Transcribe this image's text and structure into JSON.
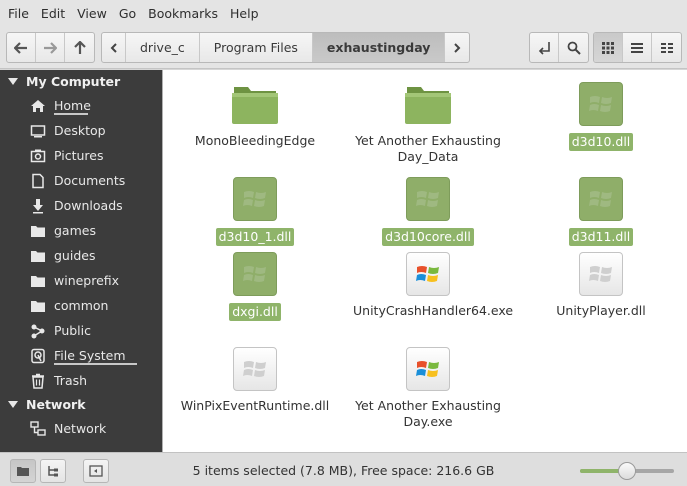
{
  "menubar": {
    "items": [
      "File",
      "Edit",
      "View",
      "Go",
      "Bookmarks",
      "Help"
    ]
  },
  "toolbar": {
    "breadcrumbs": [
      "drive_c",
      "Program Files",
      "exhaustingday"
    ],
    "active_crumb": "exhaustingday",
    "view_mode": "icons"
  },
  "sidebar": {
    "sections": [
      {
        "title": "My Computer",
        "items": [
          {
            "label": "Home",
            "icon": "home-icon",
            "underline": true
          },
          {
            "label": "Desktop",
            "icon": "desktop-icon"
          },
          {
            "label": "Pictures",
            "icon": "pictures-icon"
          },
          {
            "label": "Documents",
            "icon": "documents-icon"
          },
          {
            "label": "Downloads",
            "icon": "downloads-icon"
          },
          {
            "label": "games",
            "icon": "folder-icon"
          },
          {
            "label": "guides",
            "icon": "folder-icon"
          },
          {
            "label": "wineprefix",
            "icon": "folder-icon"
          },
          {
            "label": "common",
            "icon": "folder-icon"
          },
          {
            "label": "Public",
            "icon": "share-icon"
          },
          {
            "label": "File System",
            "icon": "harddisk-icon",
            "underline": true
          },
          {
            "label": "Trash",
            "icon": "trash-icon"
          }
        ]
      },
      {
        "title": "Network",
        "items": [
          {
            "label": "Network",
            "icon": "network-icon"
          }
        ]
      }
    ]
  },
  "files": [
    {
      "name": "MonoBleedingEdge",
      "type": "folder",
      "selected": false
    },
    {
      "name": "Yet Another Exhausting Day_Data",
      "type": "folder",
      "selected": false
    },
    {
      "name": "d3d10.dll",
      "type": "dll",
      "selected": true
    },
    {
      "name": "d3d10_1.dll",
      "type": "dll",
      "selected": true
    },
    {
      "name": "d3d10core.dll",
      "type": "dll",
      "selected": true
    },
    {
      "name": "d3d11.dll",
      "type": "dll",
      "selected": true
    },
    {
      "name": "dxgi.dll",
      "type": "dll",
      "selected": true
    },
    {
      "name": "UnityCrashHandler64.exe",
      "type": "exe",
      "selected": false
    },
    {
      "name": "UnityPlayer.dll",
      "type": "dll",
      "selected": false
    },
    {
      "name": "WinPixEventRuntime.dll",
      "type": "dll",
      "selected": false
    },
    {
      "name": "Yet Another Exhausting Day.exe",
      "type": "exe",
      "selected": false
    }
  ],
  "status": {
    "text": "5 items selected (7.8 MB), Free space: 216.6 GB",
    "zoom_level": 0.5
  },
  "colors": {
    "accent": "#8fb46a",
    "sidebar_bg": "#3c3c3c"
  }
}
